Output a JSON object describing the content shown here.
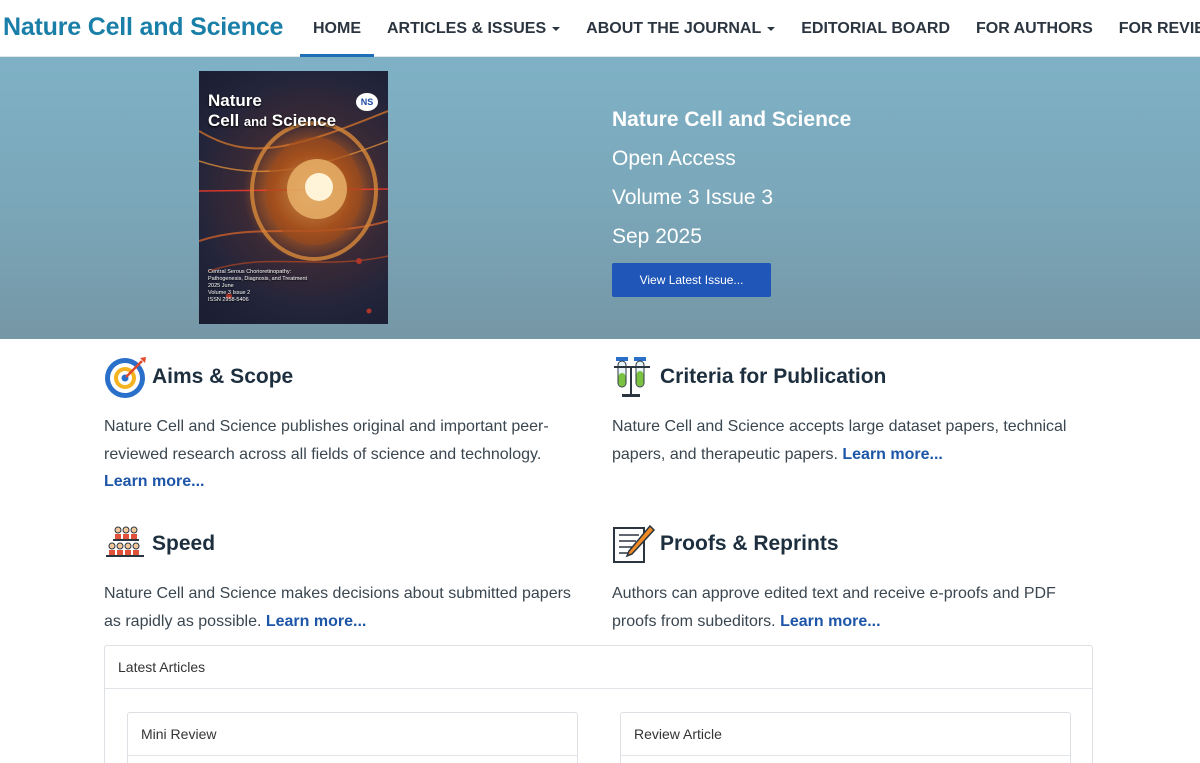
{
  "header": {
    "brand": "Nature Cell and Science",
    "nav": [
      {
        "label": "HOME",
        "active": true,
        "dropdown": false
      },
      {
        "label": "ARTICLES & ISSUES",
        "active": false,
        "dropdown": true
      },
      {
        "label": "ABOUT THE JOURNAL",
        "active": false,
        "dropdown": true
      },
      {
        "label": "EDITORIAL BOARD",
        "active": false,
        "dropdown": false
      },
      {
        "label": "FOR AUTHORS",
        "active": false,
        "dropdown": false
      },
      {
        "label": "FOR REVIEWERS",
        "active": false,
        "dropdown": false
      }
    ]
  },
  "hero": {
    "cover": {
      "title_line1": "Nature",
      "title_line2a": "Cell",
      "title_line2b": "and",
      "title_line2c": "Science",
      "logo": "NS",
      "caption_line1": "Central Serous Chorioretinopathy:",
      "caption_line2": "Pathogenesis, Diagnosis, and Treatment",
      "caption_line3": "2025       June",
      "caption_line4": "Volume 3 Issue 2",
      "caption_line5": "ISSN 2958-5406"
    },
    "journal": "Nature Cell and Science",
    "access": "Open Access",
    "issue": "Volume 3 Issue 3",
    "date": "Sep 2025",
    "button": "View Latest Issue..."
  },
  "features": [
    {
      "title": "Aims & Scope",
      "icon": "target-icon",
      "text": "Nature Cell and Science publishes original and important peer-reviewed research across all fields of science and technology. ",
      "link": "Learn more..."
    },
    {
      "title": "Criteria for Publication",
      "icon": "test-tubes-icon",
      "text": "Nature Cell and Science accepts large dataset papers, technical papers, and therapeutic papers. ",
      "link": "Learn more..."
    },
    {
      "title": "Speed",
      "icon": "people-meeting-icon",
      "text": "Nature Cell and Science makes decisions about submitted papers as rapidly as possible. ",
      "link": "Learn more..."
    },
    {
      "title": "Proofs & Reprints",
      "icon": "document-pen-icon",
      "text": "Authors can approve edited text and receive e-proofs and PDF proofs from subeditors. ",
      "link": "Learn more..."
    }
  ],
  "latest": {
    "heading": "Latest Articles",
    "cards": [
      {
        "type": "Mini Review"
      },
      {
        "type": "Review Article"
      }
    ]
  },
  "colors": {
    "brand": "#1a7fa8",
    "nav_active_underline": "#1e6fb8",
    "hero_bg": "#7aa6b8",
    "button": "#1f56b8",
    "link": "#1d56a8"
  }
}
